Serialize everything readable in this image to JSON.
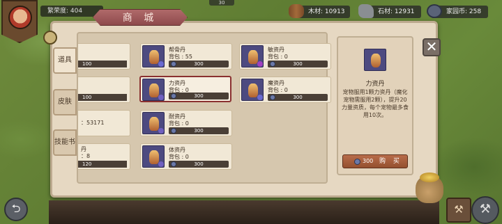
{
  "header": {
    "prosperity_label": "繁荣度: 404",
    "top_badge": "30",
    "resources": [
      {
        "label": "木材: 10913",
        "icon": "wood-log-icon"
      },
      {
        "label": "石材: 12931",
        "icon": "stone-icon"
      },
      {
        "label": "家园币: 258",
        "icon": "home-coin-icon"
      }
    ]
  },
  "shop": {
    "title": "商 城",
    "tabs": [
      {
        "label": "道具",
        "active": true
      },
      {
        "label": "皮肤",
        "active": false
      },
      {
        "label": "技能书",
        "active": false
      }
    ],
    "partial_left": [
      {
        "lines": [],
        "price": "100"
      },
      {
        "lines": [],
        "price": "100"
      },
      {
        "lines": [
          "：53171"
        ],
        "price": ""
      },
      {
        "lines": [
          "丹",
          "：8"
        ],
        "price": "120"
      }
    ],
    "items": [
      {
        "name": "帮骨丹",
        "bag": "背包 : 55",
        "price": "300",
        "tag_color": "#6a6ad0",
        "selected": false
      },
      {
        "name": "敏资丹",
        "bag": "背包 : 0",
        "price": "300",
        "tag_color": "#a040c0",
        "selected": false
      },
      {
        "name": "力资丹",
        "bag": "背包 : 0",
        "price": "300",
        "tag_color": "#7060c0",
        "selected": true
      },
      {
        "name": "魔资丹",
        "bag": "背包 : 0",
        "price": "300",
        "tag_color": "#6a6ad0",
        "selected": false
      },
      {
        "name": "耐资丹",
        "bag": "背包 : 0",
        "price": "300",
        "tag_color": "#7060c0",
        "selected": false
      },
      {
        "name": "体资丹",
        "bag": "背包 : 0",
        "price": "300",
        "tag_color": "#7060c0",
        "selected": false
      }
    ],
    "detail": {
      "name": "力资丹",
      "description": "宠物服用1颗力资丹（魔化宠物需服用2颗），提升20力量资质，每个宠物最多食用10次。",
      "buy_price": "300",
      "buy_label": "购 买"
    }
  },
  "colors": {
    "panel": "#e6d8c2",
    "banner": "#9e5a5c",
    "buy": "#a9603c"
  }
}
